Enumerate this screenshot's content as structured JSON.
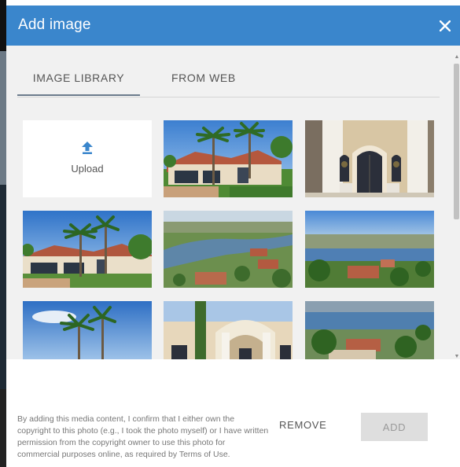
{
  "dialog": {
    "title": "Add image",
    "close_icon": "close-icon"
  },
  "tabs": [
    {
      "label": "IMAGE LIBRARY",
      "active": true
    },
    {
      "label": "FROM WEB",
      "active": false
    }
  ],
  "library": {
    "upload_label": "Upload",
    "upload_icon": "upload-arrow-icon"
  },
  "footer": {
    "disclaimer": "By adding this media content, I confirm that I either own the copyright to this photo (e.g., I took the photo myself) or I have written permission from the copyright owner to use this photo for commercial purposes online, as required by Terms of Use.",
    "remove_label": "REMOVE",
    "add_label": "ADD"
  },
  "colors": {
    "header": "#3a86cc",
    "background": "#f1f1f1",
    "add_button_disabled": "#dedede"
  }
}
